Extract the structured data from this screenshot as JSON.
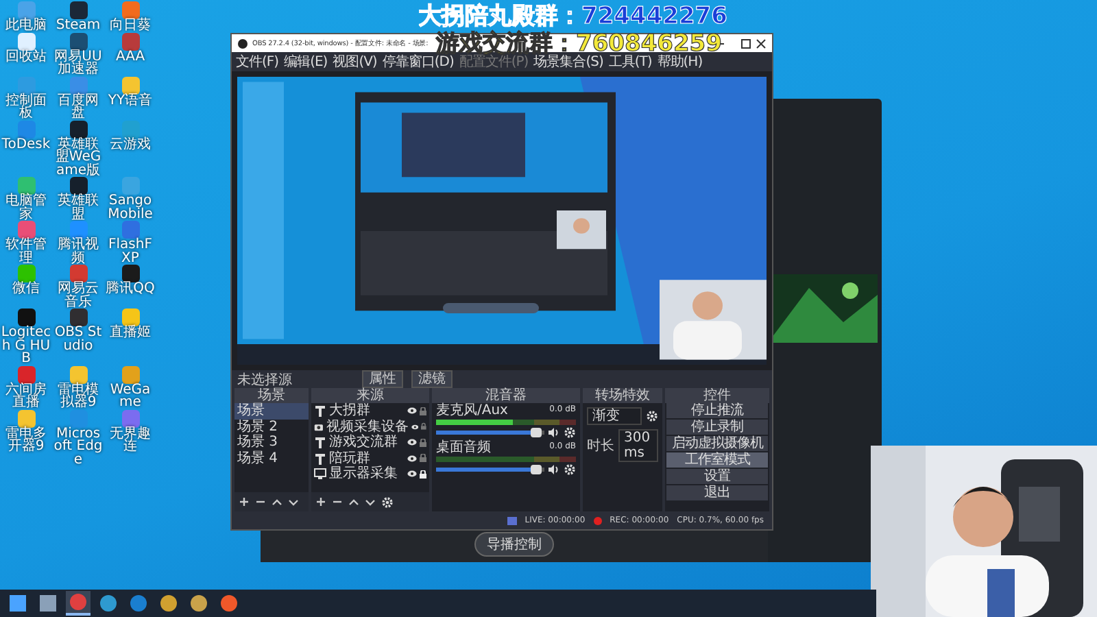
{
  "banners": [
    {
      "text": "大拐陪丸殿群：724442276",
      "color": "#1a3fd8"
    },
    {
      "text": "游戏交流群：760846259",
      "color": "#f3e93a"
    }
  ],
  "desktop_icons": [
    {
      "label": "此电脑"
    },
    {
      "label": "Steam"
    },
    {
      "label": "向日葵"
    },
    {
      "label": "回收站"
    },
    {
      "label": "网易UU加速器"
    },
    {
      "label": "AAA"
    },
    {
      "label": "控制面板"
    },
    {
      "label": "百度网盘"
    },
    {
      "label": "YY语音"
    },
    {
      "label": "ToDesk"
    },
    {
      "label": "英雄联盟WeGame版"
    },
    {
      "label": "云游戏"
    },
    {
      "label": "电脑管家"
    },
    {
      "label": "英雄联盟"
    },
    {
      "label": "SangoMobile"
    },
    {
      "label": "软件管理"
    },
    {
      "label": "腾讯视频"
    },
    {
      "label": "FlashFXP"
    },
    {
      "label": "微信"
    },
    {
      "label": "网易云音乐"
    },
    {
      "label": "腾讯QQ"
    },
    {
      "label": "Logitech G HUB"
    },
    {
      "label": "OBS Studio"
    },
    {
      "label": "直播姬"
    },
    {
      "label": "六间房直播"
    },
    {
      "label": "雷电模拟器9"
    },
    {
      "label": "WeGame"
    },
    {
      "label": "雷电多开器9"
    },
    {
      "label": "Microsoft Edge"
    },
    {
      "label": "无界趣连"
    }
  ],
  "obs": {
    "title": "OBS 27.2.4 (32-bit, windows) - 配置文件: 未命名 - 场景:",
    "menu": [
      {
        "label": "文件(F)",
        "disabled": false
      },
      {
        "label": "编辑(E)",
        "disabled": false
      },
      {
        "label": "视图(V)",
        "disabled": false
      },
      {
        "label": "停靠窗口(D)",
        "disabled": false
      },
      {
        "label": "配置文件(P)",
        "disabled": true
      },
      {
        "label": "场景集合(S)",
        "disabled": false
      },
      {
        "label": "工具(T)",
        "disabled": false
      },
      {
        "label": "帮助(H)",
        "disabled": false
      }
    ],
    "no_source_label": "未选择源",
    "properties_button": "属性",
    "filters_button": "滤镜",
    "scenes": {
      "title": "场景",
      "items": [
        {
          "label": "场景",
          "selected": true
        },
        {
          "label": "场景 2",
          "selected": false
        },
        {
          "label": "场景 3",
          "selected": false
        },
        {
          "label": "场景 4",
          "selected": false
        }
      ]
    },
    "sources": {
      "title": "来源",
      "items": [
        {
          "label": "大拐群",
          "kind": "text",
          "visible": true,
          "locked": false
        },
        {
          "label": "视频采集设备",
          "kind": "camera",
          "visible": true,
          "locked": false
        },
        {
          "label": "游戏交流群",
          "kind": "text",
          "visible": true,
          "locked": false
        },
        {
          "label": "陪玩群",
          "kind": "text",
          "visible": true,
          "locked": false
        },
        {
          "label": "显示器采集",
          "kind": "display",
          "visible": true,
          "locked": true
        }
      ]
    },
    "mixer": {
      "title": "混音器",
      "channels": [
        {
          "name": "麦克风/Aux",
          "reading": "0.0 dB",
          "meter": {
            "level": 0.55
          },
          "volume": {
            "level": 0.92
          }
        },
        {
          "name": "桌面音频",
          "reading": "0.0 dB",
          "meter": {
            "level": 0.0
          },
          "volume": {
            "level": 0.92
          }
        }
      ]
    },
    "transitions": {
      "title": "转场特效",
      "value": "渐变",
      "duration_label": "时长",
      "duration": "300 ms"
    },
    "controls": {
      "title": "控件",
      "buttons": [
        {
          "label": "停止推流",
          "hovered": false
        },
        {
          "label": "停止录制",
          "hovered": false
        },
        {
          "label": "启动虚拟摄像机",
          "hovered": false
        },
        {
          "label": "工作室模式",
          "hovered": true
        },
        {
          "label": "设置",
          "hovered": false
        },
        {
          "label": "退出",
          "hovered": false
        }
      ]
    },
    "status": {
      "live": "LIVE: 00:00:00",
      "rec": "REC: 00:00:00",
      "cpu": "CPU: 0.7%, 60.00 fps"
    }
  },
  "back_app": {
    "button": "导播控制"
  },
  "taskbar": {
    "apps": [
      {
        "active": false
      },
      {
        "active": false
      },
      {
        "active": true
      },
      {
        "active": false
      },
      {
        "active": false
      },
      {
        "active": false
      },
      {
        "active": false
      },
      {
        "active": false
      }
    ]
  }
}
